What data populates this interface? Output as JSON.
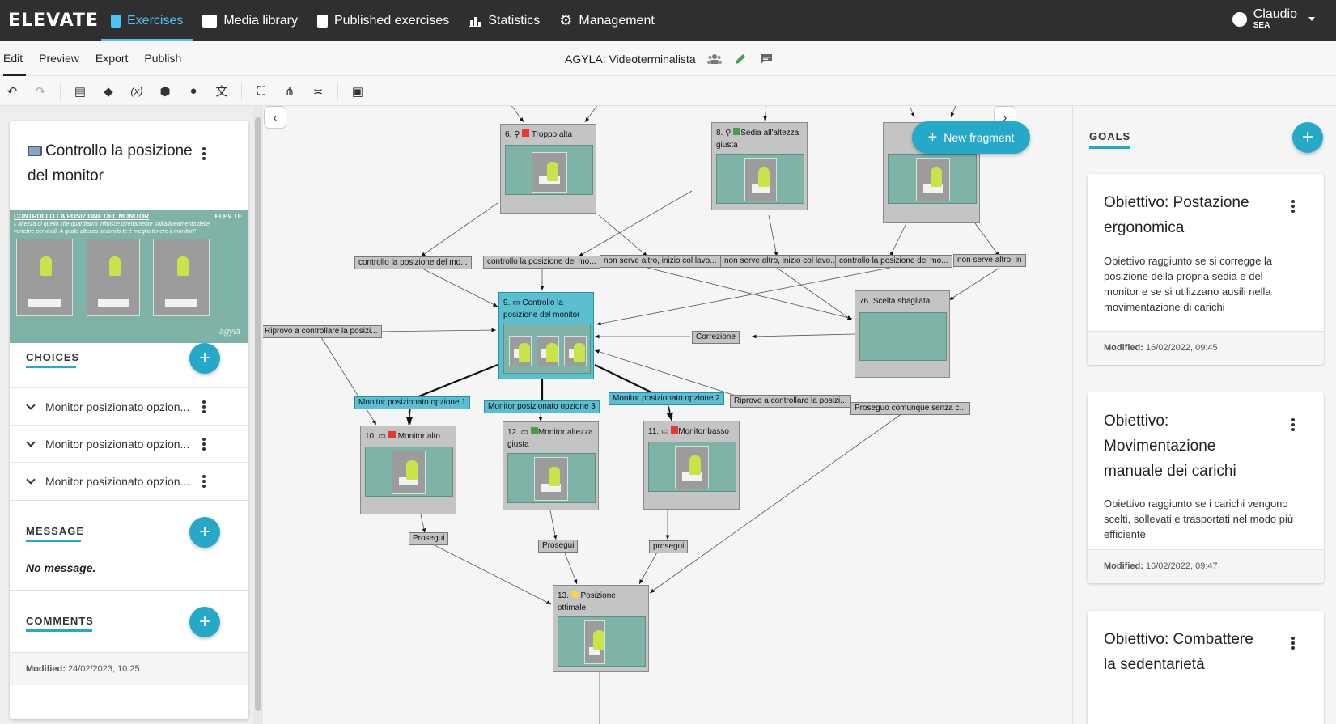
{
  "app": {
    "logo": "ELEVATE",
    "nav": [
      {
        "label": "Exercises",
        "icon": "book-icon",
        "active": true
      },
      {
        "label": "Media library",
        "icon": "images-icon"
      },
      {
        "label": "Published exercises",
        "icon": "file-icon"
      },
      {
        "label": "Statistics",
        "icon": "bar-chart-icon"
      },
      {
        "label": "Management",
        "icon": "gears-icon"
      }
    ],
    "user": {
      "name": "Claudio",
      "org": "SEA"
    }
  },
  "subnav": {
    "tabs": [
      "Edit",
      "Preview",
      "Export",
      "Publish"
    ],
    "active_tab": "Edit",
    "document_title": "AGYLA: Videoterminalista"
  },
  "toolbar": {
    "tools": [
      "undo-icon",
      "redo-icon",
      "clipboard-icon",
      "tag-icon",
      "variable-icon",
      "cube-icon",
      "palette-icon",
      "translate-icon",
      "fit-screen-icon",
      "graph-layout-icon",
      "filter-list-icon",
      "presentation-icon"
    ],
    "variable_glyph": "(x)"
  },
  "fragment": {
    "title": "Controllo la posizione del monitor",
    "thumbnail": {
      "heading": "CONTROLLO LA POSIZIONE DEL MONITOR",
      "text": "L'altezza di quello che guardiamo influisce direttamente sull'allineamento delle vertebre cervicali. A quale altezza secondo te è meglio tenere il monitor?",
      "logo": "ELEV TE",
      "brand": "agyla"
    },
    "choices_label": "CHOICES",
    "choices": [
      "Monitor posizionato opzion...",
      "Monitor posizionato opzion...",
      "Monitor posizionato opzion..."
    ],
    "message_label": "MESSAGE",
    "message": "No message.",
    "comments_label": "COMMENTS",
    "modified_label": "Modified:",
    "modified": "24/02/2023, 10:25"
  },
  "graph": {
    "new_fragment_label": "New fragment",
    "nodes": [
      {
        "id": "n6",
        "label": "6.",
        "title": "Troppo alta",
        "status": "#e53935"
      },
      {
        "id": "n8",
        "label": "8.",
        "title": "Sedia all'altezza giusta",
        "status": "#43a047"
      },
      {
        "id": "n9",
        "label": "9.",
        "title": "Controllo la posizione del monitor",
        "status": ""
      },
      {
        "id": "n76",
        "label": "76.",
        "title": "Scelta sbagliata",
        "status": ""
      },
      {
        "id": "n10",
        "label": "10.",
        "title": "Monitor alto",
        "status": "#e53935"
      },
      {
        "id": "n12",
        "label": "12.",
        "title": "Monitor altezza giusta",
        "status": "#43a047"
      },
      {
        "id": "n11",
        "label": "11.",
        "title": "Monitor basso",
        "status": "#e53935"
      },
      {
        "id": "n13",
        "label": "13.",
        "title": "Posizione ottimale",
        "status": "#fdd835"
      }
    ],
    "edge_labels": [
      {
        "text": "controllo la posizione del mo...",
        "blue": false
      },
      {
        "text": "controllo la posizione del mo...",
        "blue": false
      },
      {
        "text": "non serve altro, inizio col lavo...",
        "blue": false
      },
      {
        "text": "non serve altro, inizio col lavo...",
        "blue": false
      },
      {
        "text": "controllo la posizione del mo...",
        "blue": false
      },
      {
        "text": "non serve altro, in",
        "blue": false
      },
      {
        "text": "Riprovo a controllare la posizi...",
        "blue": false
      },
      {
        "text": "Correzione",
        "blue": false
      },
      {
        "text": "Monitor posizionato opzione 1",
        "blue": true
      },
      {
        "text": "Monitor posizionato opzione 3",
        "blue": true
      },
      {
        "text": "Monitor posizionato opzione 2",
        "blue": true
      },
      {
        "text": "Riprovo a controllare la posizi...",
        "blue": false
      },
      {
        "text": "Proseguo comunque senza c...",
        "blue": false
      },
      {
        "text": "Prosegui",
        "blue": false
      },
      {
        "text": "Prosegui",
        "blue": false
      },
      {
        "text": "prosegui",
        "blue": false
      }
    ]
  },
  "goals": {
    "label": "GOALS",
    "items": [
      {
        "title": "Obiettivo: Postazione ergonomica",
        "description": "Obiettivo raggiunto se si corregge la posizione della propria sedia e del monitor e se si utilizzano ausili nella movimentazione di carichi",
        "modified_label": "Modified:",
        "modified": "16/02/2022, 09:45"
      },
      {
        "title": "Obiettivo: Movimentazione manuale dei carichi",
        "description": "Obiettivo raggiunto se i carichi vengono scelti, sollevati e trasportati nel modo più efficiente",
        "modified_label": "Modified:",
        "modified": "16/02/2022, 09:47"
      },
      {
        "title": "Obiettivo: Combattere la sedentarietà",
        "description": "",
        "modified_label": "",
        "modified": ""
      }
    ]
  },
  "colors": {
    "accent": "#26a9c9",
    "topbar": "#2f2f2f",
    "selected_node": "#5bbfd2",
    "node": "#c4c4c4"
  }
}
